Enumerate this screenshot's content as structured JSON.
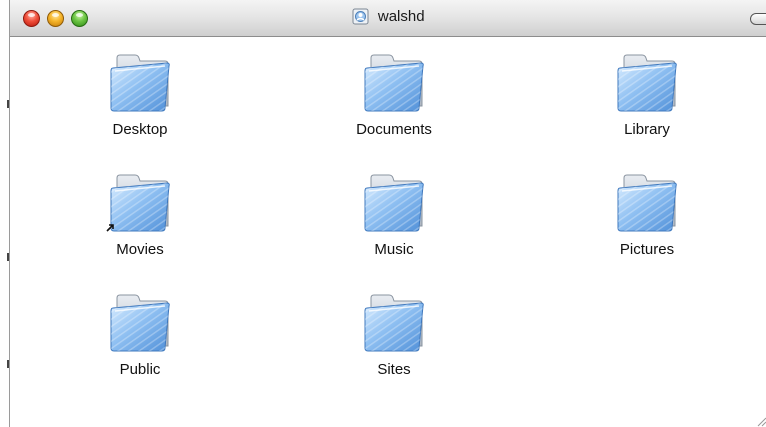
{
  "window": {
    "title": "walshd",
    "title_icon": "home-folder-icon",
    "buttons": [
      "close",
      "minimize",
      "zoom"
    ]
  },
  "folders": [
    {
      "label": "Desktop",
      "icon": "folder-icon"
    },
    {
      "label": "Documents",
      "icon": "folder-icon"
    },
    {
      "label": "Library",
      "icon": "folder-icon"
    },
    {
      "label": "Movies",
      "icon": "folder-icon"
    },
    {
      "label": "Music",
      "icon": "folder-icon"
    },
    {
      "label": "Pictures",
      "icon": "folder-icon"
    },
    {
      "label": "Public",
      "icon": "folder-icon"
    },
    {
      "label": "Sites",
      "icon": "folder-icon"
    }
  ],
  "colors": {
    "folder_blue": "#7fb2ea",
    "folder_tab": "#c7d0da",
    "close": "#f0503c",
    "minimize": "#f6b52a",
    "zoom": "#6cc544"
  }
}
